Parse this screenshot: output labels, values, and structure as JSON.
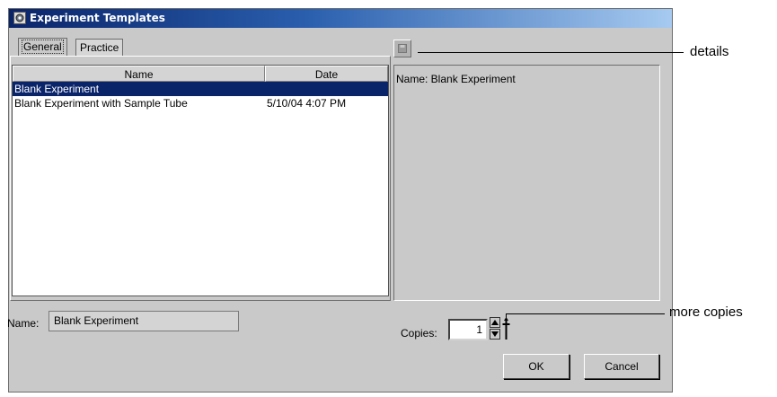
{
  "window": {
    "title": "Experiment Templates"
  },
  "tabs": [
    {
      "label": "General",
      "active": true
    },
    {
      "label": "Practice",
      "active": false
    }
  ],
  "table": {
    "columns": [
      "Name",
      "Date"
    ],
    "rows": [
      {
        "name": "Blank Experiment",
        "date": "",
        "selected": true
      },
      {
        "name": "Blank Experiment with Sample Tube",
        "date": "5/10/04 4:07 PM",
        "selected": false
      }
    ]
  },
  "details": {
    "text": "Name: Blank Experiment",
    "button_icon": "details-icon"
  },
  "name_field": {
    "label": "Name:",
    "value": "Blank Experiment"
  },
  "copies": {
    "label": "Copies:",
    "value": "1"
  },
  "buttons": {
    "ok": "OK",
    "cancel": "Cancel"
  },
  "callouts": {
    "details": "details",
    "more_copies": "more copies"
  },
  "colors": {
    "selection": "#0a246a",
    "window_bg": "#c9c9c9",
    "title_start": "#0a246a"
  }
}
